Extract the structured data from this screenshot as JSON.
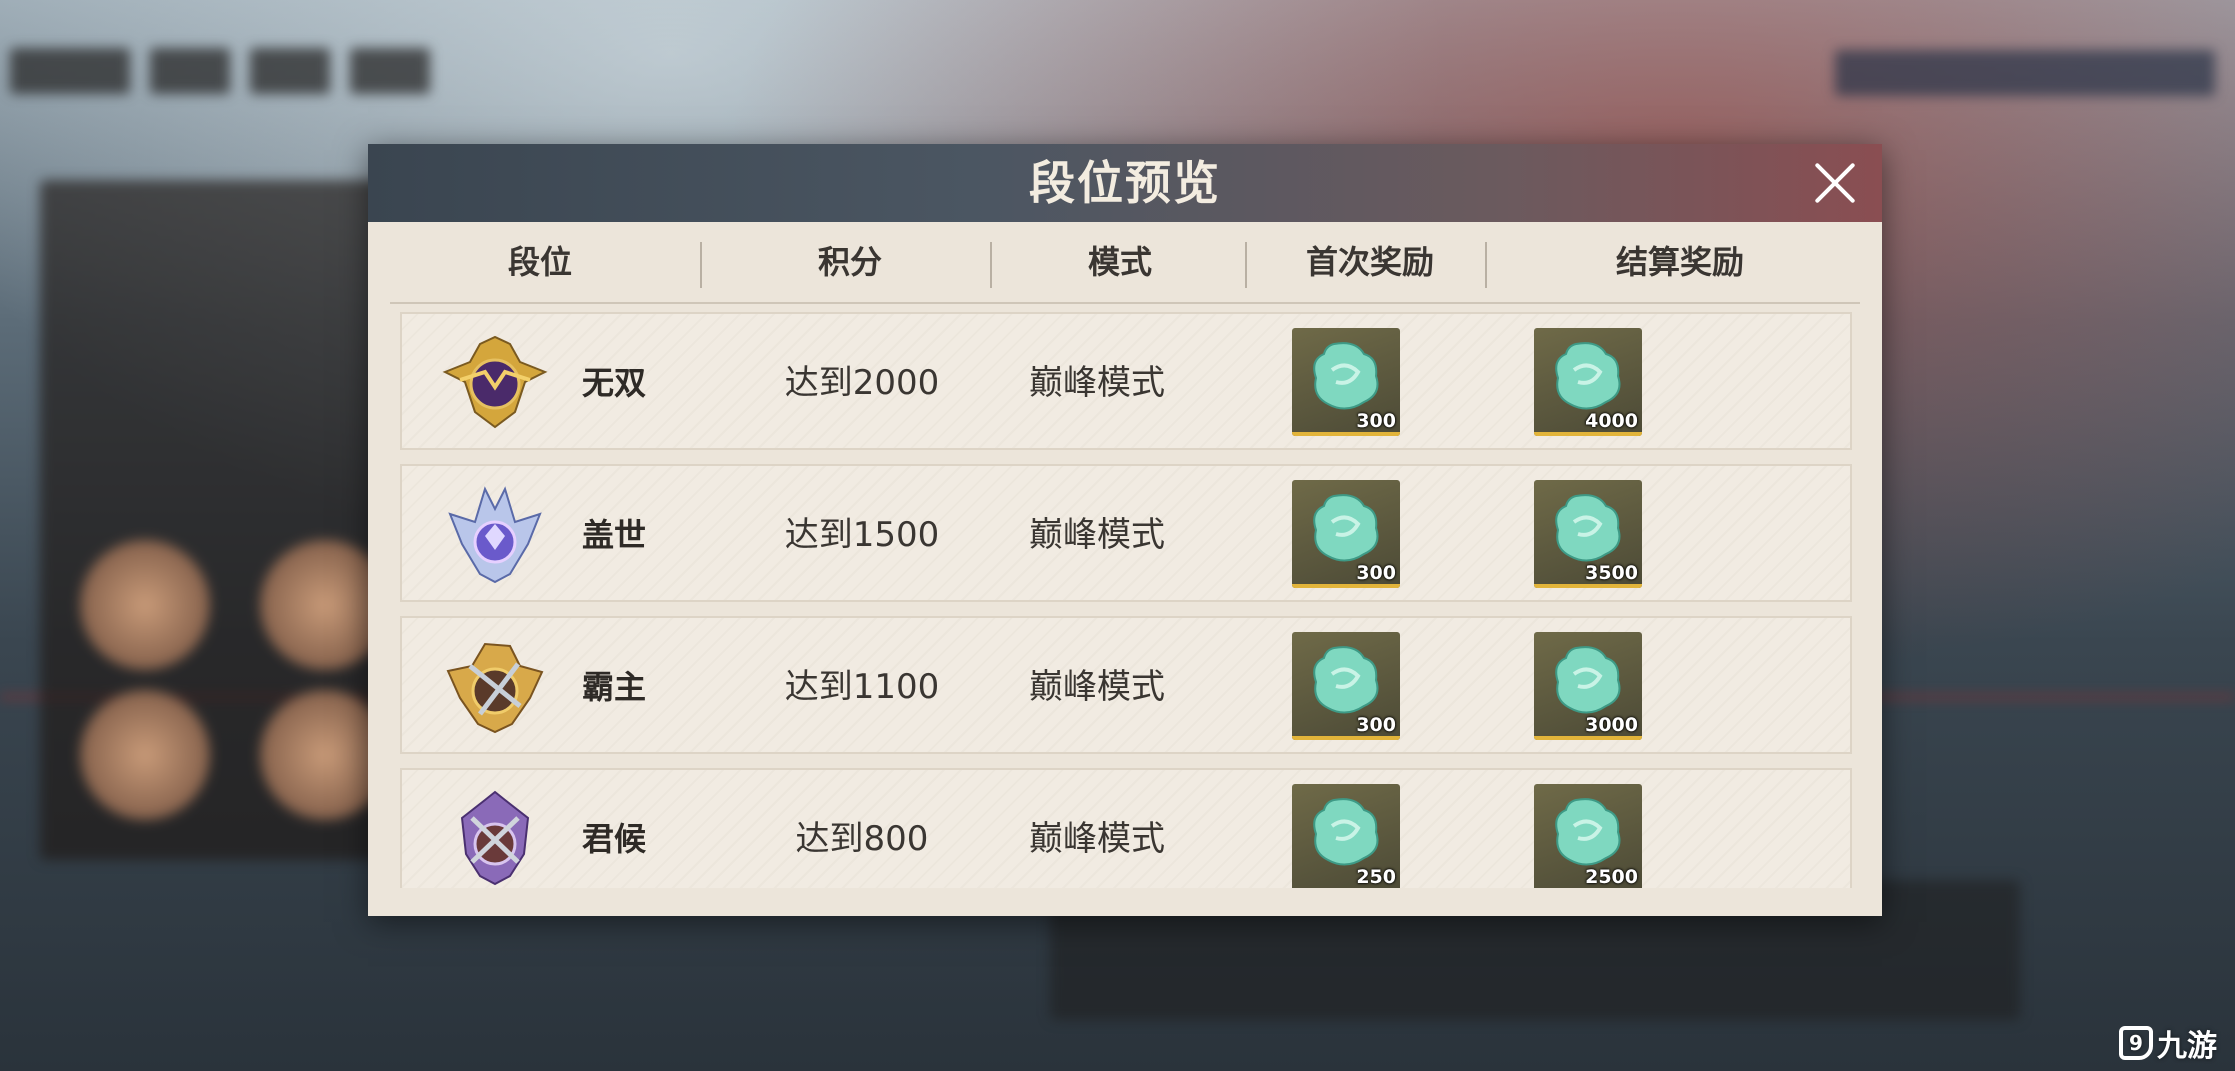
{
  "dialog": {
    "title": "段位预览",
    "columns": [
      "段位",
      "积分",
      "模式",
      "首次奖励",
      "结算奖励"
    ]
  },
  "ranks": [
    {
      "name": "无双",
      "score": "达到2000",
      "mode": "巅峰模式",
      "first_reward": "300",
      "settle_reward": "4000",
      "emblem_color": "#6a3a8a"
    },
    {
      "name": "盖世",
      "score": "达到1500",
      "mode": "巅峰模式",
      "first_reward": "300",
      "settle_reward": "3500",
      "emblem_color": "#5a78c8"
    },
    {
      "name": "霸主",
      "score": "达到1100",
      "mode": "巅峰模式",
      "first_reward": "300",
      "settle_reward": "3000",
      "emblem_color": "#c8962e"
    },
    {
      "name": "君候",
      "score": "达到800",
      "mode": "巅峰模式",
      "first_reward": "250",
      "settle_reward": "2500",
      "emblem_color": "#7a5aa8"
    }
  ],
  "reward_icon": "jade-token-icon",
  "watermark": {
    "text": "九游"
  }
}
